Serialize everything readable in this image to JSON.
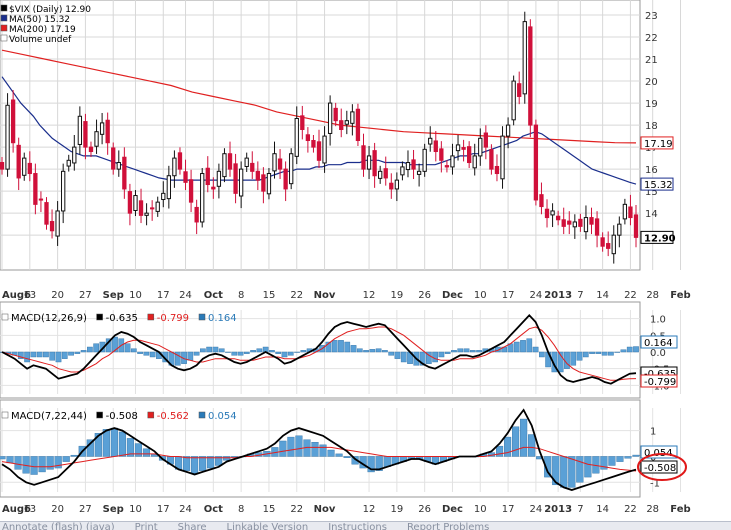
{
  "colors": {
    "up": "#111111",
    "down": "#d0103a",
    "ma50": "#1a2e8c",
    "ma200": "#e02020",
    "macd_line": "#000000",
    "signal_line": "#e02020",
    "histogram": "#5aa0d6",
    "highlight": "#e01818"
  },
  "chart_data": [
    {
      "type": "candlestick",
      "title": "$VIX (Daily) 12.90",
      "legend": [
        {
          "label": "$VIX (Daily) 12.90",
          "color": "#000000"
        },
        {
          "label": "MA(50) 15.32",
          "color": "#1a2e8c"
        },
        {
          "label": "MA(200) 17.19",
          "color": "#e02020"
        },
        {
          "label": "Volume undef",
          "color": "#000000"
        }
      ],
      "legend_position": "top-left",
      "ylim": [
        11.6,
        23.5
      ],
      "y_ticks": [
        13,
        14,
        15,
        16,
        17,
        18,
        19,
        20,
        21,
        22,
        23
      ],
      "x_ticks": [
        "Aug6",
        "13",
        "20",
        "27",
        "Sep",
        "10",
        "17",
        "24",
        "Oct",
        "8",
        "15",
        "22",
        "Nov",
        "12",
        "19",
        "26",
        "Dec",
        "10",
        "17",
        "24",
        "2013",
        "7",
        "14",
        "22",
        "28",
        "Feb"
      ],
      "x_tick_index": [
        0,
        5,
        10,
        15,
        20,
        24,
        29,
        33,
        38,
        43,
        48,
        53,
        58,
        66,
        71,
        76,
        81,
        86,
        91,
        96,
        100,
        104,
        108,
        113,
        117,
        122
      ],
      "close": [
        16.0,
        18.9,
        17.2,
        15.6,
        16.5,
        15.8,
        14.4,
        14.6,
        13.5,
        13.2,
        14.1,
        15.9,
        16.4,
        17.0,
        18.4,
        17.0,
        16.8,
        17.7,
        18.1,
        17.2,
        16.0,
        16.3,
        15.1,
        14.0,
        14.8,
        13.9,
        14.0,
        14.2,
        14.5,
        14.9,
        15.7,
        16.5,
        16.0,
        15.4,
        14.5,
        13.6,
        15.8,
        15.3,
        15.1,
        15.9,
        16.7,
        16.0,
        14.9,
        16.0,
        16.5,
        15.9,
        15.5,
        15.0,
        15.8,
        16.7,
        16.0,
        15.1,
        16.7,
        18.3,
        17.8,
        17.3,
        17.0,
        16.4,
        17.5,
        19.0,
        18.2,
        17.8,
        18.2,
        18.6,
        17.3,
        16.0,
        16.6,
        15.7,
        15.9,
        15.6,
        15.1,
        15.5,
        16.1,
        16.3,
        16.0,
        15.9,
        16.9,
        17.4,
        16.8,
        16.4,
        16.1,
        16.6,
        17.1,
        16.9,
        16.3,
        16.6,
        17.4,
        17.0,
        16.0,
        15.8,
        17.5,
        18.0,
        20.0,
        19.3,
        22.7,
        18.0,
        14.6,
        14.3,
        13.8,
        14.1,
        13.7,
        13.4,
        13.5,
        13.6,
        13.4,
        13.8,
        13.5,
        13.0,
        12.5,
        12.4,
        13.0,
        13.5,
        14.4,
        13.8,
        12.9
      ],
      "ma50": [
        20.2,
        19.8,
        19.4,
        19.0,
        18.7,
        18.4,
        18.0,
        17.7,
        17.4,
        17.2,
        17.0,
        16.8,
        16.7,
        16.6,
        16.6,
        16.6,
        16.5,
        16.4,
        16.3,
        16.2,
        16.1,
        16.0,
        15.9,
        15.8,
        15.7,
        15.6,
        15.55,
        15.5,
        15.5,
        15.5,
        15.5,
        15.5,
        15.5,
        15.5,
        15.5,
        15.5,
        15.5,
        15.5,
        15.5,
        15.5,
        15.5,
        15.5,
        15.6,
        15.7,
        15.8,
        15.9,
        15.9,
        16.0,
        16.0,
        16.0,
        16.1,
        16.1,
        16.2,
        16.2,
        16.2,
        16.3,
        16.3,
        16.3,
        16.4,
        16.4,
        16.4,
        16.3,
        16.3,
        16.3,
        16.3,
        16.2,
        16.2,
        16.2,
        16.2,
        16.2,
        16.3,
        16.4,
        16.5,
        16.6,
        16.6,
        16.7,
        16.7,
        16.8,
        16.9,
        17.0,
        17.1,
        17.2,
        17.3,
        17.5,
        17.6,
        17.7,
        17.6,
        17.4,
        17.2,
        17.0,
        16.8,
        16.6,
        16.4,
        16.2,
        16.0,
        15.9,
        15.8,
        15.7,
        15.6,
        15.5,
        15.4,
        15.32
      ],
      "ma200": [
        21.4,
        21.2,
        21.0,
        20.8,
        20.6,
        20.4,
        20.2,
        20.0,
        19.8,
        19.5,
        19.3,
        19.1,
        18.9,
        18.6,
        18.4,
        18.2,
        18.0,
        17.9,
        17.8,
        17.7,
        17.65,
        17.6,
        17.55,
        17.5,
        17.45,
        17.4,
        17.35,
        17.3,
        17.25,
        17.2,
        17.19
      ]
    },
    {
      "type": "macd",
      "title": "MACD(12,26,9) -0.635, -0.799, 0.164",
      "legend": [
        {
          "label": "MACD(12,26,9)",
          "color": "#000000"
        },
        {
          "label": "-0.635",
          "color": "#000000"
        },
        {
          "label": "-0.799",
          "color": "#e02020"
        },
        {
          "label": "0.164",
          "color": "#2a7ab8"
        }
      ],
      "legend_position": "top-left",
      "ylim": [
        -1.2,
        1.2
      ],
      "y_ticks": [
        "1.0",
        "0.5",
        "0.0",
        "-0.5",
        "-1.0"
      ],
      "value_tags": [
        "0.164",
        "-0.635",
        "-0.799"
      ],
      "macd": [
        0.0,
        -0.1,
        -0.2,
        -0.35,
        -0.5,
        -0.4,
        -0.45,
        -0.5,
        -0.65,
        -0.8,
        -0.75,
        -0.7,
        -0.65,
        -0.5,
        -0.3,
        -0.1,
        0.1,
        0.3,
        0.5,
        0.6,
        0.55,
        0.45,
        0.3,
        0.2,
        0.1,
        0.0,
        -0.2,
        -0.4,
        -0.5,
        -0.55,
        -0.5,
        -0.4,
        -0.2,
        -0.1,
        -0.05,
        -0.1,
        -0.2,
        -0.3,
        -0.35,
        -0.3,
        -0.2,
        -0.1,
        0.0,
        -0.1,
        -0.2,
        -0.35,
        -0.3,
        -0.2,
        -0.1,
        0.0,
        0.1,
        0.3,
        0.55,
        0.75,
        0.85,
        0.9,
        0.85,
        0.8,
        0.75,
        0.8,
        0.85,
        0.8,
        0.6,
        0.4,
        0.2,
        0.0,
        -0.2,
        -0.35,
        -0.45,
        -0.5,
        -0.4,
        -0.3,
        -0.2,
        -0.1,
        -0.1,
        -0.15,
        -0.1,
        0.0,
        0.1,
        0.2,
        0.3,
        0.5,
        0.7,
        0.9,
        1.1,
        0.9,
        0.5,
        0.0,
        -0.4,
        -0.7,
        -0.85,
        -0.9,
        -0.85,
        -0.8,
        -0.75,
        -0.8,
        -0.9,
        -0.95,
        -0.85,
        -0.75,
        -0.65,
        -0.635
      ],
      "signal": [
        0.0,
        -0.05,
        -0.1,
        -0.15,
        -0.2,
        -0.25,
        -0.3,
        -0.35,
        -0.4,
        -0.5,
        -0.55,
        -0.6,
        -0.6,
        -0.55,
        -0.45,
        -0.35,
        -0.2,
        -0.1,
        0.05,
        0.2,
        0.3,
        0.35,
        0.35,
        0.3,
        0.25,
        0.2,
        0.1,
        0.0,
        -0.1,
        -0.2,
        -0.25,
        -0.3,
        -0.3,
        -0.25,
        -0.2,
        -0.2,
        -0.2,
        -0.2,
        -0.25,
        -0.25,
        -0.25,
        -0.2,
        -0.15,
        -0.15,
        -0.15,
        -0.2,
        -0.2,
        -0.2,
        -0.15,
        -0.1,
        0.0,
        0.1,
        0.25,
        0.4,
        0.5,
        0.6,
        0.65,
        0.7,
        0.7,
        0.72,
        0.75,
        0.75,
        0.7,
        0.6,
        0.5,
        0.35,
        0.2,
        0.05,
        -0.1,
        -0.2,
        -0.25,
        -0.25,
        -0.25,
        -0.2,
        -0.2,
        -0.2,
        -0.15,
        -0.1,
        0.0,
        0.05,
        0.15,
        0.25,
        0.4,
        0.55,
        0.7,
        0.75,
        0.65,
        0.45,
        0.2,
        -0.1,
        -0.35,
        -0.5,
        -0.6,
        -0.65,
        -0.7,
        -0.75,
        -0.8,
        -0.85,
        -0.85,
        -0.82,
        -0.8,
        -0.799
      ]
    },
    {
      "type": "macd",
      "title": "MACD(7,22,44) -0.508, -0.562, 0.054",
      "legend": [
        {
          "label": "MACD(7,22,44)",
          "color": "#000000"
        },
        {
          "label": "-0.508",
          "color": "#000000"
        },
        {
          "label": "-0.562",
          "color": "#e02020"
        },
        {
          "label": "0.054",
          "color": "#2a7ab8"
        }
      ],
      "legend_position": "top-left",
      "ylim": [
        -1.3,
        1.8
      ],
      "y_ticks": [
        "1",
        "0",
        "-1"
      ],
      "value_tags": [
        "0.054",
        "-0.508"
      ],
      "macd": [
        -0.3,
        -0.5,
        -0.8,
        -1.0,
        -1.1,
        -1.0,
        -0.9,
        -0.8,
        -0.5,
        -0.2,
        0.2,
        0.5,
        0.8,
        1.0,
        1.1,
        1.0,
        0.8,
        0.6,
        0.4,
        0.2,
        -0.1,
        -0.3,
        -0.5,
        -0.6,
        -0.7,
        -0.6,
        -0.5,
        -0.4,
        -0.2,
        -0.1,
        0.0,
        0.1,
        0.2,
        0.3,
        0.5,
        0.8,
        1.0,
        1.1,
        1.0,
        0.9,
        0.8,
        0.6,
        0.4,
        0.2,
        -0.1,
        -0.3,
        -0.5,
        -0.5,
        -0.4,
        -0.3,
        -0.2,
        -0.1,
        -0.1,
        -0.2,
        -0.3,
        -0.2,
        -0.1,
        0.0,
        0.0,
        0.0,
        0.1,
        0.2,
        0.5,
        0.9,
        1.4,
        1.8,
        1.2,
        0.2,
        -0.6,
        -1.0,
        -1.2,
        -1.3,
        -1.2,
        -1.1,
        -1.0,
        -0.9,
        -0.8,
        -0.7,
        -0.6,
        -0.508
      ],
      "signal": [
        -0.2,
        -0.25,
        -0.3,
        -0.35,
        -0.4,
        -0.4,
        -0.4,
        -0.35,
        -0.3,
        -0.25,
        -0.2,
        -0.15,
        -0.1,
        -0.05,
        0.0,
        0.05,
        0.1,
        0.1,
        0.1,
        0.1,
        0.05,
        0.0,
        0.0,
        -0.05,
        -0.05,
        -0.05,
        -0.05,
        -0.05,
        -0.05,
        -0.05,
        0.0,
        0.0,
        0.05,
        0.1,
        0.15,
        0.2,
        0.25,
        0.3,
        0.35,
        0.35,
        0.35,
        0.35,
        0.3,
        0.25,
        0.2,
        0.15,
        0.1,
        0.05,
        0.0,
        0.0,
        0.0,
        0.0,
        0.0,
        0.0,
        0.0,
        0.0,
        0.0,
        0.0,
        0.0,
        0.0,
        0.0,
        0.05,
        0.1,
        0.15,
        0.25,
        0.35,
        0.35,
        0.3,
        0.2,
        0.1,
        0.0,
        -0.1,
        -0.2,
        -0.3,
        -0.35,
        -0.4,
        -0.45,
        -0.5,
        -0.53,
        -0.562
      ]
    }
  ],
  "price_tags": [
    "17.19",
    "15.32",
    "12.90"
  ],
  "bottom_links": [
    "Annotate (flash) (java)",
    "Print",
    "Share",
    "Linkable Version",
    "Instructions",
    "Report Problems"
  ]
}
